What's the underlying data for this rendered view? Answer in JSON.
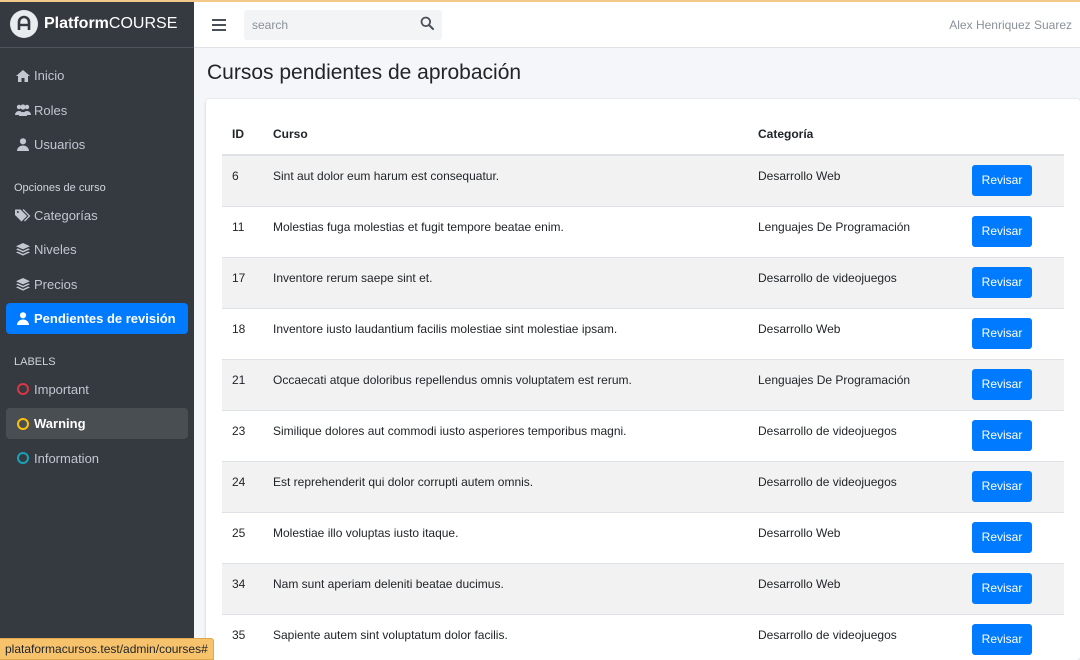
{
  "brand": {
    "bold": "Platform",
    "light": "COURSE"
  },
  "sidebar": {
    "items": [
      {
        "label": "Inicio",
        "icon": "home-icon"
      },
      {
        "label": "Roles",
        "icon": "users-icon"
      },
      {
        "label": "Usuarios",
        "icon": "user-icon"
      }
    ],
    "course_header": "Opciones de curso",
    "course_items": [
      {
        "label": "Categorías",
        "icon": "tags-icon"
      },
      {
        "label": "Niveles",
        "icon": "layers-icon"
      },
      {
        "label": "Precios",
        "icon": "layers-icon"
      },
      {
        "label": "Pendientes de revisión",
        "icon": "user-icon"
      }
    ],
    "labels_header": "LABELS",
    "labels": [
      {
        "label": "Important",
        "color": "#dc3545"
      },
      {
        "label": "Warning",
        "color": "#ffc107"
      },
      {
        "label": "Information",
        "color": "#17a2b8"
      }
    ]
  },
  "navbar": {
    "search_placeholder": "search",
    "user_name": "Alex Henriquez Suarez"
  },
  "page": {
    "title": "Cursos pendientes de aprobación"
  },
  "table": {
    "headers": {
      "id": "ID",
      "course": "Curso",
      "category": "Categoría"
    },
    "button_label": "Revisar",
    "rows": [
      {
        "id": "6",
        "course": "Sint aut dolor eum harum est consequatur.",
        "category": "Desarrollo Web"
      },
      {
        "id": "11",
        "course": "Molestias fuga molestias et fugit tempore beatae enim.",
        "category": "Lenguajes De Programación"
      },
      {
        "id": "17",
        "course": "Inventore rerum saepe sint et.",
        "category": "Desarrollo de videojuegos"
      },
      {
        "id": "18",
        "course": "Inventore iusto laudantium facilis molestiae sint molestiae ipsam.",
        "category": "Desarrollo Web"
      },
      {
        "id": "21",
        "course": "Occaecati atque doloribus repellendus omnis voluptatem est rerum.",
        "category": "Lenguajes De Programación"
      },
      {
        "id": "23",
        "course": "Similique dolores aut commodi iusto asperiores temporibus magni.",
        "category": "Desarrollo de videojuegos"
      },
      {
        "id": "24",
        "course": "Est reprehenderit qui dolor corrupti autem omnis.",
        "category": "Desarrollo de videojuegos"
      },
      {
        "id": "25",
        "course": "Molestiae illo voluptas iusto itaque.",
        "category": "Desarrollo Web"
      },
      {
        "id": "34",
        "course": "Nam sunt aperiam deleniti beatae ducimus.",
        "category": "Desarrollo Web"
      },
      {
        "id": "35",
        "course": "Sapiente autem sint voluptatum dolor facilis.",
        "category": "Desarrollo de videojuegos"
      }
    ]
  },
  "status_url": "plataformacursos.test/admin/courses#",
  "colors": {
    "sidebar_bg": "#343a40",
    "accent": "#007bff",
    "status_bg": "#f7c26c"
  }
}
